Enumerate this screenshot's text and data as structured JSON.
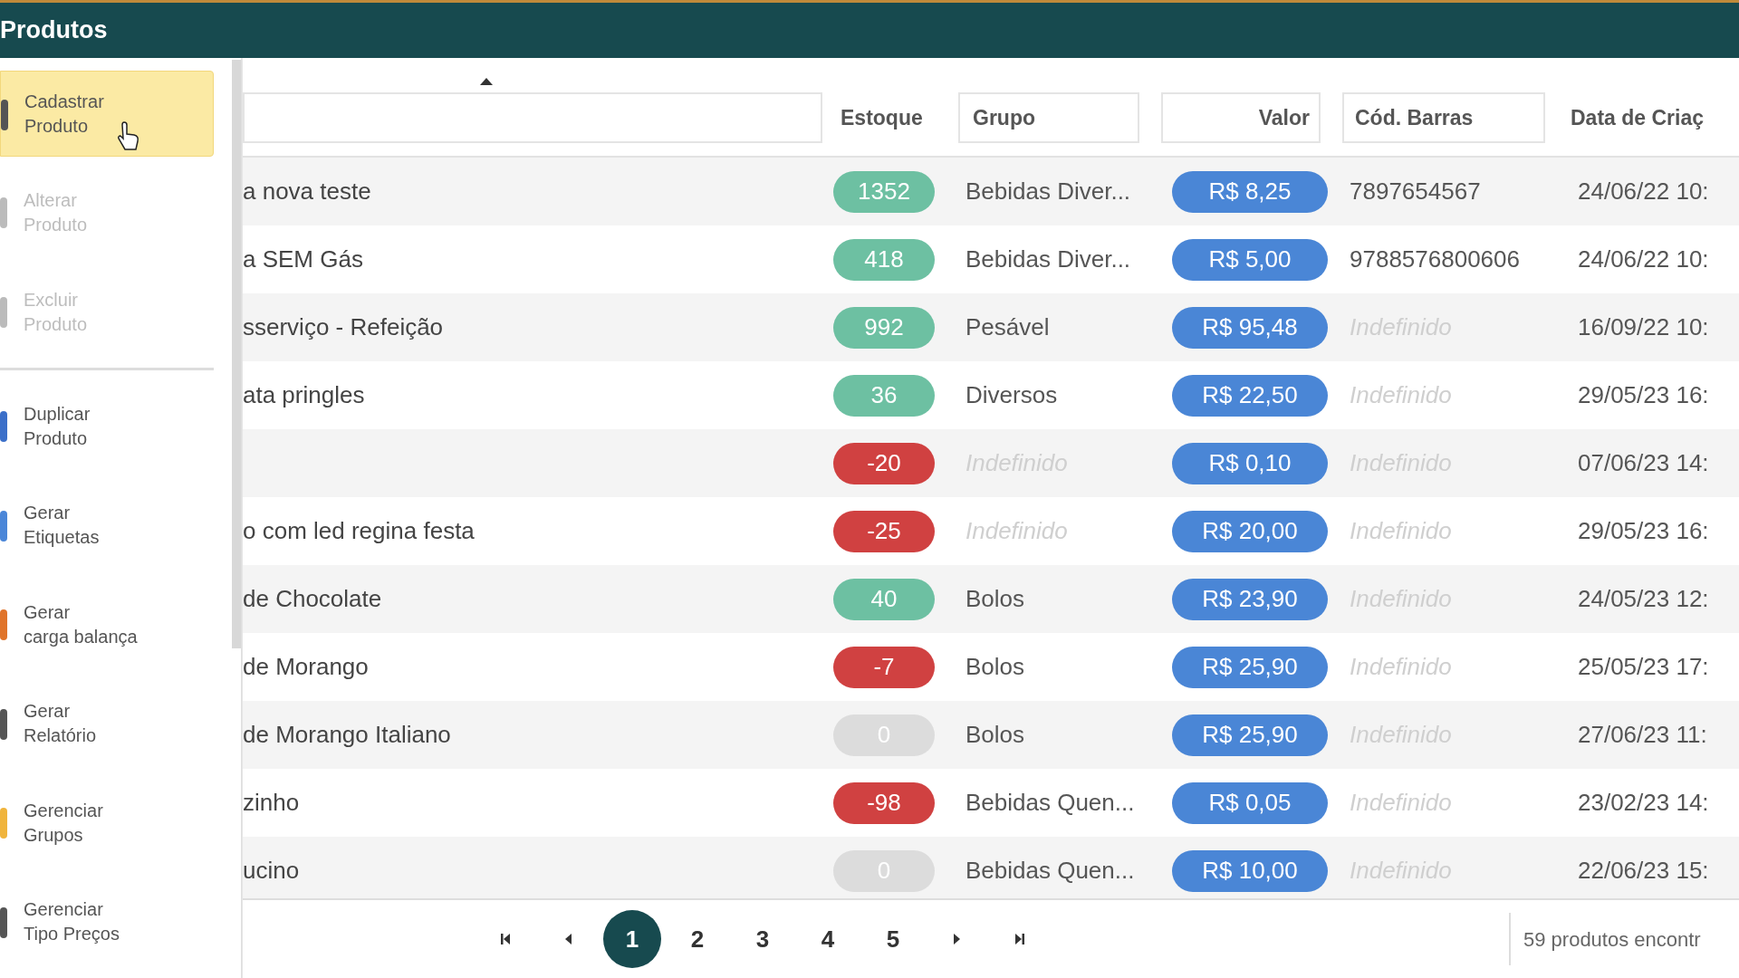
{
  "window": {
    "title": "Produtos"
  },
  "sidebar": {
    "items": [
      {
        "label": "Cadastrar\nProduto",
        "selected": true,
        "disabled": false,
        "color": "#555555"
      },
      {
        "label": "Alterar\nProduto",
        "selected": false,
        "disabled": true,
        "color": "#bbbbbb"
      },
      {
        "label": "Excluir\nProduto",
        "selected": false,
        "disabled": true,
        "color": "#bbbbbb"
      },
      {
        "label": "Duplicar\nProduto",
        "selected": false,
        "disabled": false,
        "color": "#3b6fc9"
      },
      {
        "label": "Gerar\nEtiquetas",
        "selected": false,
        "disabled": false,
        "color": "#4a86d8"
      },
      {
        "label": "Gerar\ncarga balança",
        "selected": false,
        "disabled": false,
        "color": "#e0742a"
      },
      {
        "label": "Gerar\nRelatório",
        "selected": false,
        "disabled": false,
        "color": "#555555"
      },
      {
        "label": "Gerenciar\nGrupos",
        "selected": false,
        "disabled": false,
        "color": "#f0b43c"
      },
      {
        "label": "Gerenciar\nTipo Preços",
        "selected": false,
        "disabled": false,
        "color": "#555555"
      }
    ]
  },
  "table": {
    "columns": [
      {
        "label": "Estoque"
      },
      {
        "label": "Grupo"
      },
      {
        "label": "Valor"
      },
      {
        "label": "Cód. Barras"
      },
      {
        "label": "Data de Criaç"
      }
    ],
    "rows": [
      {
        "name": "a nova teste",
        "stock": {
          "text": "1352",
          "color": "#6dc0a2"
        },
        "group": {
          "text": "Bebidas Diver...",
          "unset": false
        },
        "value": "R$ 8,25",
        "barcode": {
          "text": "7897654567",
          "unset": false
        },
        "date": "24/06/22 10:"
      },
      {
        "name": "a SEM Gás",
        "stock": {
          "text": "418",
          "color": "#6dc0a2"
        },
        "group": {
          "text": "Bebidas Diver...",
          "unset": false
        },
        "value": "R$ 5,00",
        "barcode": {
          "text": "9788576800606",
          "unset": false
        },
        "date": "24/06/22 10:"
      },
      {
        "name": "sserviço - Refeição",
        "stock": {
          "text": "992",
          "color": "#6dc0a2"
        },
        "group": {
          "text": "Pesável",
          "unset": false
        },
        "value": "R$ 95,48",
        "barcode": {
          "text": "Indefinido",
          "unset": true
        },
        "date": "16/09/22 10:"
      },
      {
        "name": "ata pringles",
        "stock": {
          "text": "36",
          "color": "#6dc0a2"
        },
        "group": {
          "text": "Diversos",
          "unset": false
        },
        "value": "R$ 22,50",
        "barcode": {
          "text": "Indefinido",
          "unset": true
        },
        "date": "29/05/23 16:"
      },
      {
        "stock": {
          "text": "-20",
          "color": "#d04141"
        },
        "group": {
          "text": "Indefinido",
          "unset": true
        },
        "value": "R$ 0,10",
        "barcode": {
          "text": "Indefinido",
          "unset": true
        },
        "date": "07/06/23 14:"
      },
      {
        "name": "o com led regina festa",
        "stock": {
          "text": "-25",
          "color": "#d04141"
        },
        "group": {
          "text": "Indefinido",
          "unset": true
        },
        "value": "R$ 20,00",
        "barcode": {
          "text": "Indefinido",
          "unset": true
        },
        "date": "29/05/23 16:"
      },
      {
        "name": "de Chocolate",
        "stock": {
          "text": "40",
          "color": "#6dc0a2"
        },
        "group": {
          "text": "Bolos",
          "unset": false
        },
        "value": "R$ 23,90",
        "barcode": {
          "text": "Indefinido",
          "unset": true
        },
        "date": "24/05/23 12:"
      },
      {
        "name": "de Morango",
        "stock": {
          "text": "-7",
          "color": "#d04141"
        },
        "group": {
          "text": "Bolos",
          "unset": false
        },
        "value": "R$ 25,90",
        "barcode": {
          "text": "Indefinido",
          "unset": true
        },
        "date": "25/05/23 17:"
      },
      {
        "name": "de Morango Italiano",
        "stock": {
          "text": "0",
          "color": "#dcdcdc"
        },
        "group": {
          "text": "Bolos",
          "unset": false
        },
        "value": "R$ 25,90",
        "barcode": {
          "text": "Indefinido",
          "unset": true
        },
        "date": "27/06/23 11:"
      },
      {
        "name": "zinho",
        "stock": {
          "text": "-98",
          "color": "#d04141"
        },
        "group": {
          "text": "Bebidas Quen...",
          "unset": false
        },
        "value": "R$ 0,05",
        "barcode": {
          "text": "Indefinido",
          "unset": true
        },
        "date": "23/02/23 14:"
      },
      {
        "name": "ucino",
        "stock": {
          "text": "0",
          "color": "#dcdcdc"
        },
        "group": {
          "text": "Bebidas Quen...",
          "unset": false
        },
        "value": "R$ 10,00",
        "barcode": {
          "text": "Indefinido",
          "unset": true
        },
        "date": "22/06/23 15:"
      }
    ]
  },
  "pagination": {
    "pages": [
      {
        "label": "1",
        "selected": true
      },
      {
        "label": "2",
        "selected": false
      },
      {
        "label": "3",
        "selected": false
      },
      {
        "label": "4",
        "selected": false
      },
      {
        "label": "5",
        "selected": false
      }
    ],
    "summary": "59 produtos encontr"
  }
}
